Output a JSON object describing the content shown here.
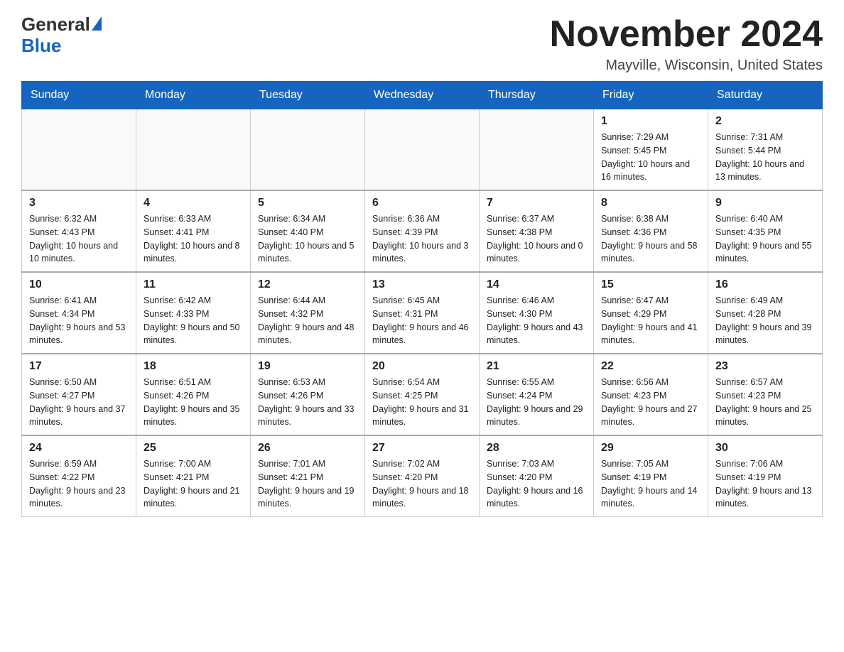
{
  "header": {
    "logo_general": "General",
    "logo_blue": "Blue",
    "month_title": "November 2024",
    "location": "Mayville, Wisconsin, United States"
  },
  "days_of_week": [
    "Sunday",
    "Monday",
    "Tuesday",
    "Wednesday",
    "Thursday",
    "Friday",
    "Saturday"
  ],
  "weeks": [
    [
      {
        "day": null,
        "sunrise": null,
        "sunset": null,
        "daylight": null
      },
      {
        "day": null,
        "sunrise": null,
        "sunset": null,
        "daylight": null
      },
      {
        "day": null,
        "sunrise": null,
        "sunset": null,
        "daylight": null
      },
      {
        "day": null,
        "sunrise": null,
        "sunset": null,
        "daylight": null
      },
      {
        "day": null,
        "sunrise": null,
        "sunset": null,
        "daylight": null
      },
      {
        "day": "1",
        "sunrise": "Sunrise: 7:29 AM",
        "sunset": "Sunset: 5:45 PM",
        "daylight": "Daylight: 10 hours and 16 minutes."
      },
      {
        "day": "2",
        "sunrise": "Sunrise: 7:31 AM",
        "sunset": "Sunset: 5:44 PM",
        "daylight": "Daylight: 10 hours and 13 minutes."
      }
    ],
    [
      {
        "day": "3",
        "sunrise": "Sunrise: 6:32 AM",
        "sunset": "Sunset: 4:43 PM",
        "daylight": "Daylight: 10 hours and 10 minutes."
      },
      {
        "day": "4",
        "sunrise": "Sunrise: 6:33 AM",
        "sunset": "Sunset: 4:41 PM",
        "daylight": "Daylight: 10 hours and 8 minutes."
      },
      {
        "day": "5",
        "sunrise": "Sunrise: 6:34 AM",
        "sunset": "Sunset: 4:40 PM",
        "daylight": "Daylight: 10 hours and 5 minutes."
      },
      {
        "day": "6",
        "sunrise": "Sunrise: 6:36 AM",
        "sunset": "Sunset: 4:39 PM",
        "daylight": "Daylight: 10 hours and 3 minutes."
      },
      {
        "day": "7",
        "sunrise": "Sunrise: 6:37 AM",
        "sunset": "Sunset: 4:38 PM",
        "daylight": "Daylight: 10 hours and 0 minutes."
      },
      {
        "day": "8",
        "sunrise": "Sunrise: 6:38 AM",
        "sunset": "Sunset: 4:36 PM",
        "daylight": "Daylight: 9 hours and 58 minutes."
      },
      {
        "day": "9",
        "sunrise": "Sunrise: 6:40 AM",
        "sunset": "Sunset: 4:35 PM",
        "daylight": "Daylight: 9 hours and 55 minutes."
      }
    ],
    [
      {
        "day": "10",
        "sunrise": "Sunrise: 6:41 AM",
        "sunset": "Sunset: 4:34 PM",
        "daylight": "Daylight: 9 hours and 53 minutes."
      },
      {
        "day": "11",
        "sunrise": "Sunrise: 6:42 AM",
        "sunset": "Sunset: 4:33 PM",
        "daylight": "Daylight: 9 hours and 50 minutes."
      },
      {
        "day": "12",
        "sunrise": "Sunrise: 6:44 AM",
        "sunset": "Sunset: 4:32 PM",
        "daylight": "Daylight: 9 hours and 48 minutes."
      },
      {
        "day": "13",
        "sunrise": "Sunrise: 6:45 AM",
        "sunset": "Sunset: 4:31 PM",
        "daylight": "Daylight: 9 hours and 46 minutes."
      },
      {
        "day": "14",
        "sunrise": "Sunrise: 6:46 AM",
        "sunset": "Sunset: 4:30 PM",
        "daylight": "Daylight: 9 hours and 43 minutes."
      },
      {
        "day": "15",
        "sunrise": "Sunrise: 6:47 AM",
        "sunset": "Sunset: 4:29 PM",
        "daylight": "Daylight: 9 hours and 41 minutes."
      },
      {
        "day": "16",
        "sunrise": "Sunrise: 6:49 AM",
        "sunset": "Sunset: 4:28 PM",
        "daylight": "Daylight: 9 hours and 39 minutes."
      }
    ],
    [
      {
        "day": "17",
        "sunrise": "Sunrise: 6:50 AM",
        "sunset": "Sunset: 4:27 PM",
        "daylight": "Daylight: 9 hours and 37 minutes."
      },
      {
        "day": "18",
        "sunrise": "Sunrise: 6:51 AM",
        "sunset": "Sunset: 4:26 PM",
        "daylight": "Daylight: 9 hours and 35 minutes."
      },
      {
        "day": "19",
        "sunrise": "Sunrise: 6:53 AM",
        "sunset": "Sunset: 4:26 PM",
        "daylight": "Daylight: 9 hours and 33 minutes."
      },
      {
        "day": "20",
        "sunrise": "Sunrise: 6:54 AM",
        "sunset": "Sunset: 4:25 PM",
        "daylight": "Daylight: 9 hours and 31 minutes."
      },
      {
        "day": "21",
        "sunrise": "Sunrise: 6:55 AM",
        "sunset": "Sunset: 4:24 PM",
        "daylight": "Daylight: 9 hours and 29 minutes."
      },
      {
        "day": "22",
        "sunrise": "Sunrise: 6:56 AM",
        "sunset": "Sunset: 4:23 PM",
        "daylight": "Daylight: 9 hours and 27 minutes."
      },
      {
        "day": "23",
        "sunrise": "Sunrise: 6:57 AM",
        "sunset": "Sunset: 4:23 PM",
        "daylight": "Daylight: 9 hours and 25 minutes."
      }
    ],
    [
      {
        "day": "24",
        "sunrise": "Sunrise: 6:59 AM",
        "sunset": "Sunset: 4:22 PM",
        "daylight": "Daylight: 9 hours and 23 minutes."
      },
      {
        "day": "25",
        "sunrise": "Sunrise: 7:00 AM",
        "sunset": "Sunset: 4:21 PM",
        "daylight": "Daylight: 9 hours and 21 minutes."
      },
      {
        "day": "26",
        "sunrise": "Sunrise: 7:01 AM",
        "sunset": "Sunset: 4:21 PM",
        "daylight": "Daylight: 9 hours and 19 minutes."
      },
      {
        "day": "27",
        "sunrise": "Sunrise: 7:02 AM",
        "sunset": "Sunset: 4:20 PM",
        "daylight": "Daylight: 9 hours and 18 minutes."
      },
      {
        "day": "28",
        "sunrise": "Sunrise: 7:03 AM",
        "sunset": "Sunset: 4:20 PM",
        "daylight": "Daylight: 9 hours and 16 minutes."
      },
      {
        "day": "29",
        "sunrise": "Sunrise: 7:05 AM",
        "sunset": "Sunset: 4:19 PM",
        "daylight": "Daylight: 9 hours and 14 minutes."
      },
      {
        "day": "30",
        "sunrise": "Sunrise: 7:06 AM",
        "sunset": "Sunset: 4:19 PM",
        "daylight": "Daylight: 9 hours and 13 minutes."
      }
    ]
  ]
}
